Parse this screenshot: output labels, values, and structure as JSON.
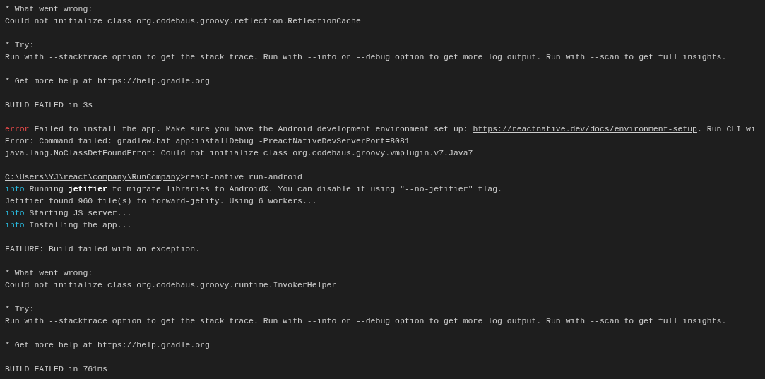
{
  "terminal": {
    "blocks": [
      {
        "lines": [
          [
            {
              "kind": "text",
              "text": "* What went wrong:"
            }
          ],
          [
            {
              "kind": "text",
              "text": "Could not initialize class org.codehaus.groovy.reflection.ReflectionCache"
            }
          ]
        ]
      },
      {
        "lines": [
          [
            {
              "kind": "text",
              "text": "* Try:"
            }
          ],
          [
            {
              "kind": "text",
              "text": "Run with --stacktrace option to get the stack trace. Run with --info or --debug option to get more log output. Run with --scan to get full insights."
            }
          ]
        ]
      },
      {
        "lines": [
          [
            {
              "kind": "text",
              "text": "* Get more help at https://help.gradle.org"
            }
          ]
        ]
      },
      {
        "lines": [
          [
            {
              "kind": "text",
              "text": "BUILD FAILED in 3s"
            }
          ]
        ]
      },
      {
        "lines": [
          [
            {
              "kind": "error",
              "text": "error"
            },
            {
              "kind": "text",
              "text": " Failed to install the app. Make sure you have the Android development environment set up: "
            },
            {
              "kind": "link",
              "text": "https://reactnative.dev/docs/environment-setup"
            },
            {
              "kind": "text",
              "text": ". Run CLI wi"
            }
          ],
          [
            {
              "kind": "text",
              "text": "Error: Command failed: gradlew.bat app:installDebug -PreactNativeDevServerPort=8081"
            }
          ],
          [
            {
              "kind": "text",
              "text": "java.lang.NoClassDefFoundError: Could not initialize class org.codehaus.groovy.vmplugin.v7.Java7"
            }
          ]
        ]
      },
      {
        "lines": [
          [
            {
              "kind": "path",
              "text": "C:\\Users\\YJ\\react\\company\\RunCompany"
            },
            {
              "kind": "text",
              "text": ">react-native run-android"
            }
          ],
          [
            {
              "kind": "info",
              "text": "info"
            },
            {
              "kind": "text",
              "text": " Running "
            },
            {
              "kind": "bold",
              "text": "jetifier"
            },
            {
              "kind": "text",
              "text": " to migrate libraries to AndroidX. You can disable it using \"--no-jetifier\" flag."
            }
          ],
          [
            {
              "kind": "text",
              "text": "Jetifier found 960 file(s) to forward-jetify. Using 6 workers..."
            }
          ],
          [
            {
              "kind": "info",
              "text": "info"
            },
            {
              "kind": "text",
              "text": " Starting JS server..."
            }
          ],
          [
            {
              "kind": "info",
              "text": "info"
            },
            {
              "kind": "text",
              "text": " Installing the app..."
            }
          ]
        ]
      },
      {
        "lines": [
          [
            {
              "kind": "text",
              "text": "FAILURE: Build failed with an exception."
            }
          ]
        ]
      },
      {
        "lines": [
          [
            {
              "kind": "text",
              "text": "* What went wrong:"
            }
          ],
          [
            {
              "kind": "text",
              "text": "Could not initialize class org.codehaus.groovy.runtime.InvokerHelper"
            }
          ]
        ]
      },
      {
        "lines": [
          [
            {
              "kind": "text",
              "text": "* Try:"
            }
          ],
          [
            {
              "kind": "text",
              "text": "Run with --stacktrace option to get the stack trace. Run with --info or --debug option to get more log output. Run with --scan to get full insights."
            }
          ]
        ]
      },
      {
        "lines": [
          [
            {
              "kind": "text",
              "text": "* Get more help at https://help.gradle.org"
            }
          ]
        ]
      },
      {
        "lines": [
          [
            {
              "kind": "text",
              "text": "BUILD FAILED in 761ms"
            }
          ]
        ]
      }
    ]
  }
}
